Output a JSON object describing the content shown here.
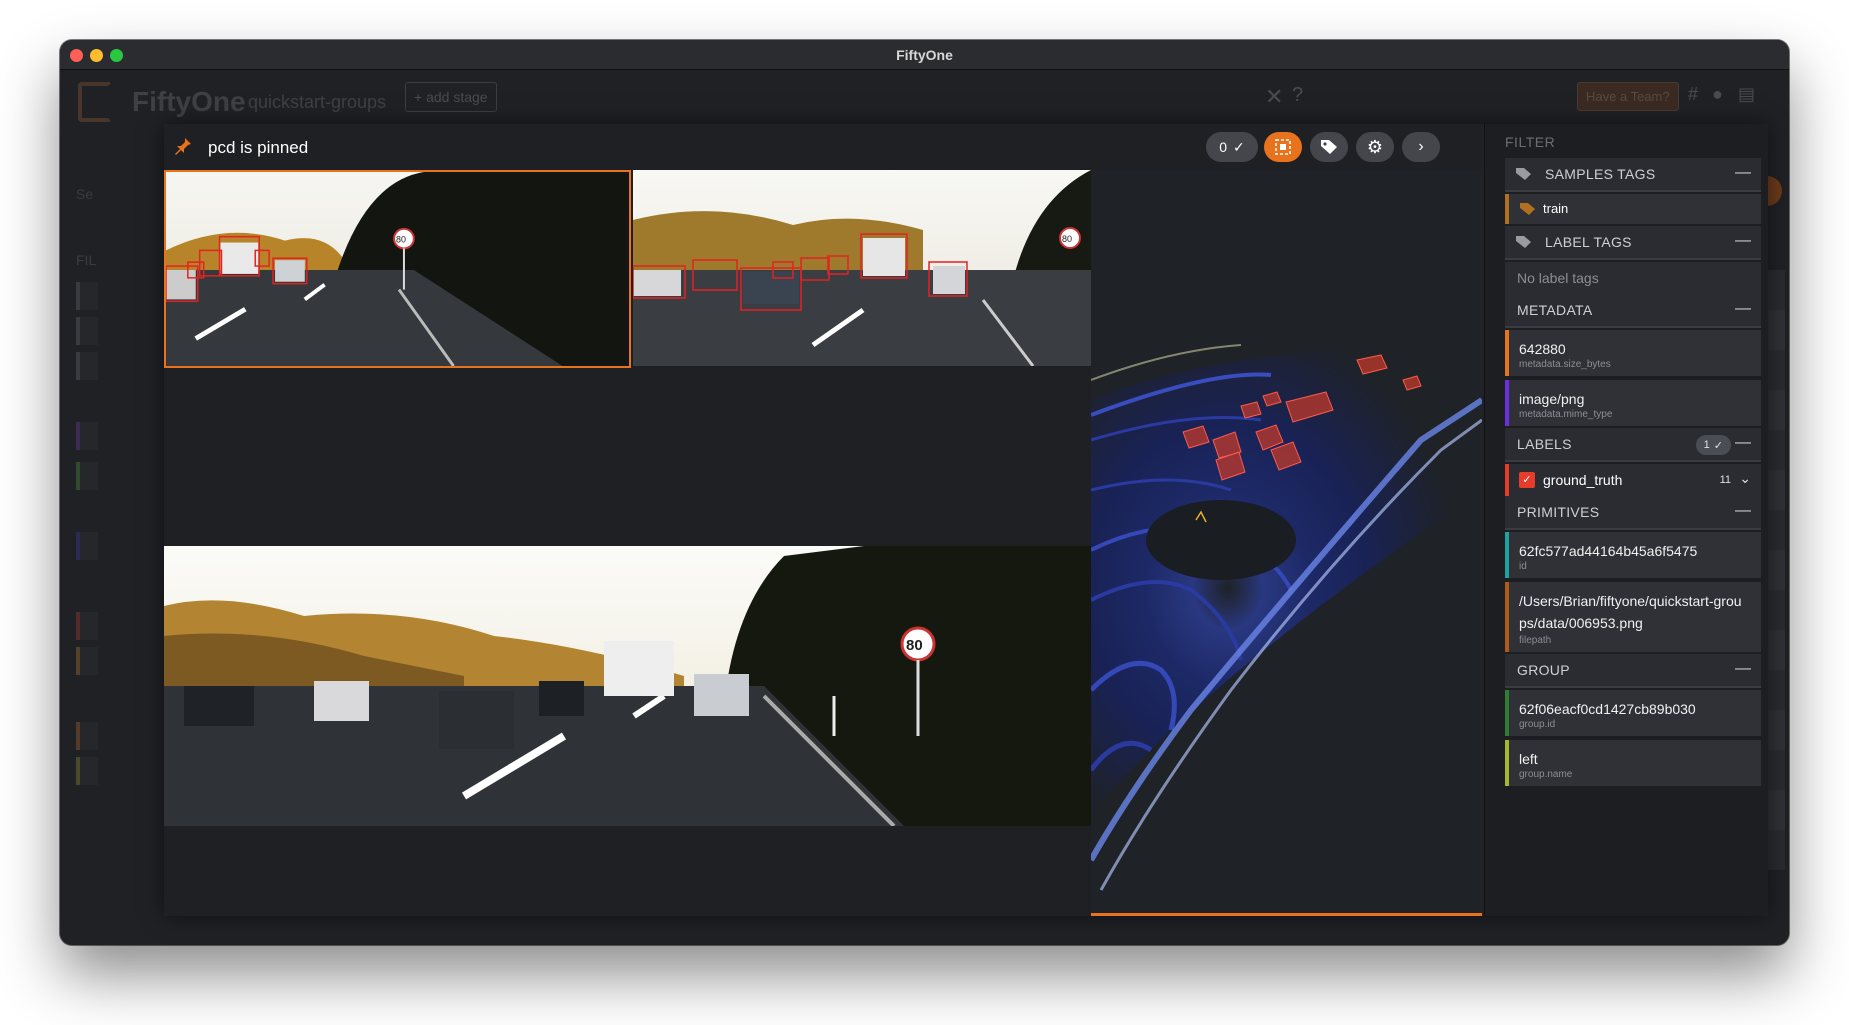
{
  "window": {
    "title": "FiftyOne"
  },
  "background": {
    "brand": "FiftyOne",
    "dataset": "quickstart-groups",
    "add_stage": "+ add stage",
    "team_button": "Have a Team?"
  },
  "modal": {
    "pinned_text": "pcd is pinned",
    "selected_count": "0",
    "speed_limit": "80"
  },
  "sidebar": {
    "filter_label": "FILTER",
    "sections": {
      "samples_tags": "SAMPLES TAGS",
      "label_tags": "LABEL TAGS",
      "metadata": "METADATA",
      "labels": "LABELS",
      "primitives": "PRIMITIVES",
      "group": "GROUP"
    },
    "collapse_symbol": "—",
    "sample_tag": "train",
    "no_label_tags": "No label tags",
    "metadata": [
      {
        "value": "642880",
        "key": "metadata.size_bytes",
        "color": "#e8731c"
      },
      {
        "value": "image/png",
        "key": "metadata.mime_type",
        "color": "#6b2fe0"
      }
    ],
    "labels_count": "1",
    "ground_truth": {
      "label": "ground_truth",
      "count": "11",
      "color": "#e83c2a"
    },
    "primitives": [
      {
        "value": "62fc577ad44164b45a6f5475",
        "key": "id",
        "color": "#1fa3a0"
      },
      {
        "value": "/Users/Brian/fiftyone/quickstart-groups/data/006953.png",
        "key": "filepath",
        "color": "#b05a1a"
      }
    ],
    "group": [
      {
        "value": "62f06eacf0cd1427cb89b030",
        "key": "group.id",
        "color": "#2e7d32"
      },
      {
        "value": "left",
        "key": "group.name",
        "color": "#a8b62a"
      }
    ]
  }
}
